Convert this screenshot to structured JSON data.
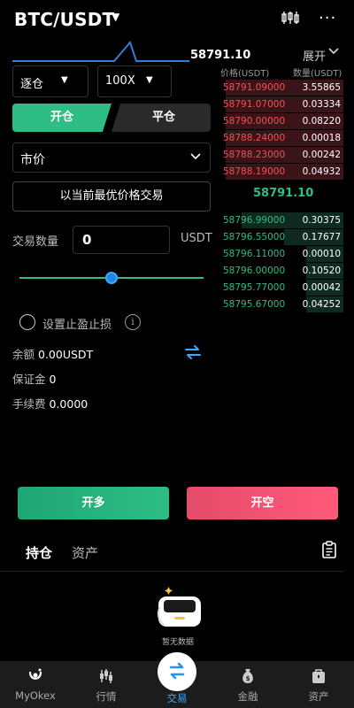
{
  "header": {
    "pair": "BTC/USDT",
    "pair_caret": "▼",
    "more": "···"
  },
  "ticker": {
    "last_price": "58791.10",
    "expand_label": "展开"
  },
  "orderbook": {
    "price_header": "价格(USDT)",
    "qty_header": "数量(USDT)",
    "asks": [
      {
        "price": "58791.09000",
        "qty": "3.55865",
        "depth": 0.95
      },
      {
        "price": "58791.07000",
        "qty": "0.03334",
        "depth": 0.95
      },
      {
        "price": "58790.00000",
        "qty": "0.08220",
        "depth": 0.95
      },
      {
        "price": "58788.24000",
        "qty": "0.00018",
        "depth": 0.95
      },
      {
        "price": "58788.23000",
        "qty": "0.00242",
        "depth": 0.95
      },
      {
        "price": "58788.19000",
        "qty": "0.04932",
        "depth": 0.95
      }
    ],
    "mid_price": "58791.10",
    "bids": [
      {
        "price": "58796.99000",
        "qty": "0.30375",
        "depth": 0.82
      },
      {
        "price": "58796.55000",
        "qty": "0.17677",
        "depth": 0.48
      },
      {
        "price": "58796.11000",
        "qty": "0.00010",
        "depth": 0.3
      },
      {
        "price": "58796.00000",
        "qty": "0.10520",
        "depth": 0.3
      },
      {
        "price": "58795.77000",
        "qty": "0.00042",
        "depth": 0.3
      },
      {
        "price": "58795.67000",
        "qty": "0.04252",
        "depth": 0.3
      }
    ]
  },
  "form": {
    "margin_mode": "逐仓",
    "leverage": "100X",
    "caret": "▼",
    "tab_open": "开仓",
    "tab_close": "平仓",
    "order_type": "市价",
    "best_price_button": "以当前最优价格交易",
    "qty_label": "交易数量",
    "qty_value": "0",
    "qty_unit": "USDT",
    "slider_fraction": 0.5,
    "sl_label": "设置止盈止损",
    "info_glyph": "i",
    "balance_label": "余额",
    "balance_value": "0.00USDT",
    "margin_label": "保证金",
    "margin_value": "0",
    "fee_label": "手续费",
    "fee_value": "0.0000"
  },
  "actions": {
    "long": "开多",
    "short": "开空"
  },
  "positions": {
    "tab_positions": "持仓",
    "tab_assets": "资产",
    "empty_text": "暂无数据"
  },
  "nav": {
    "items": [
      {
        "label": "MyOkex",
        "icon": "okex-logo-icon"
      },
      {
        "label": "行情",
        "icon": "market-icon"
      },
      {
        "label": "交易",
        "icon": "trade-icon"
      },
      {
        "label": "金融",
        "icon": "finance-bag-icon"
      },
      {
        "label": "资产",
        "icon": "wallet-icon"
      }
    ],
    "active_index": 2
  },
  "colors": {
    "buy": "#2ebd85",
    "sell": "#ef5350",
    "accent": "#42a5f5",
    "background": "#000000"
  }
}
